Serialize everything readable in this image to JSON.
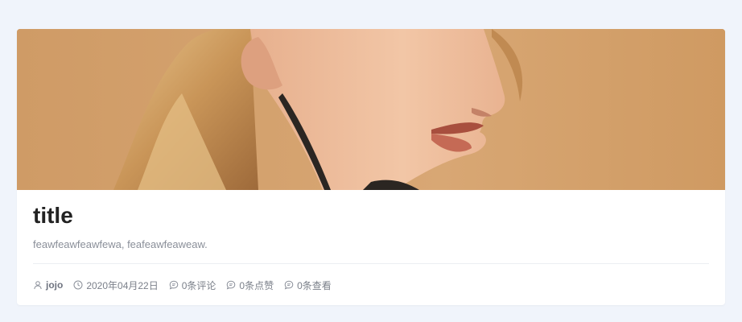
{
  "post": {
    "title": "title",
    "description": "feawfeawfeawfewa, feafeawfeaweaw.",
    "cover_alt": "cover image of a woman in profile",
    "meta": {
      "author": "jojo",
      "date": "2020年04月22日",
      "comments": "0条评论",
      "likes": "0条点赞",
      "views": "0条查看"
    }
  },
  "icons": {
    "author": "user-icon",
    "date": "clock-icon",
    "comments": "comment-icon",
    "likes": "comment-icon",
    "views": "comment-icon"
  },
  "colors": {
    "page_bg": "#f0f4fb",
    "card_bg": "#ffffff",
    "cover_bg": "#d2a16b",
    "title": "#222222",
    "muted": "#8a8f99"
  }
}
